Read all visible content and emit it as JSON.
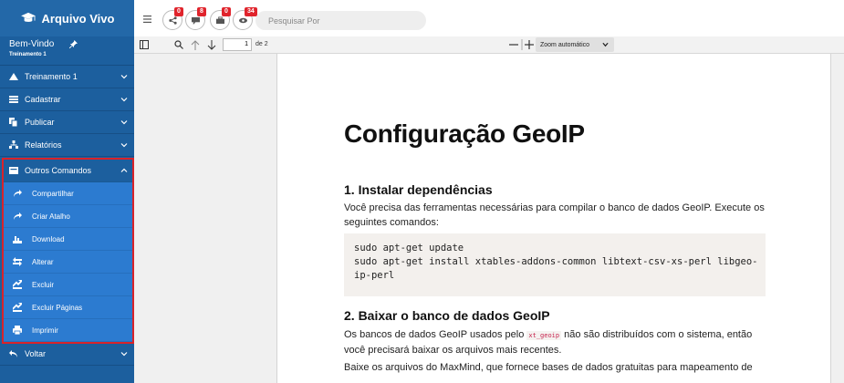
{
  "sidebar": {
    "brand": "Arquivo Vivo",
    "welcome": "Bem-Vindo",
    "user": "Treinamento 1",
    "menu": [
      {
        "label": "Treinamento 1"
      },
      {
        "label": "Cadastrar"
      },
      {
        "label": "Publicar"
      },
      {
        "label": "Relatórios"
      }
    ],
    "open_menu": {
      "label": "Outros Comandos",
      "items": [
        "Compartilhar",
        "Criar Atalho",
        "Download",
        "Alterar",
        "Excluir",
        "Excluir Páginas",
        "Imprimir"
      ]
    },
    "back": "Voltar"
  },
  "header": {
    "badges": [
      "0",
      "8",
      "0",
      "34"
    ],
    "search_placeholder": "Pesquisar Por"
  },
  "pdf_toolbar": {
    "page_current": "1",
    "page_total": "de 2",
    "zoom": "Zoom automático"
  },
  "document": {
    "title": "Configuração GeoIP",
    "section1_title": "1. Instalar dependências",
    "section1_text": "Você precisa das ferramentas necessárias para compilar o banco de dados GeoIP. Execute os seguintes comandos:",
    "code_lines": [
      "sudo apt-get update",
      "sudo apt-get install xtables-addons-common libtext-csv-xs-perl libgeo-",
      "ip-perl"
    ],
    "section2_title": "2. Baixar o banco de dados GeoIP",
    "section2_text_before": "Os bancos de dados GeoIP usados pelo ",
    "section2_code": "xt_geoip",
    "section2_text_after": " não são distribuídos com o sistema, então você precisará baixar os arquivos mais recentes.",
    "section2_text2": "Baixe os arquivos do MaxMind, que fornece bases de dados gratuitas para mapeamento de"
  },
  "colors": {
    "sidebar": "#1c5f9e",
    "submenu": "#2c7bd0",
    "highlight_border": "#d8232a",
    "badge": "#e0242c"
  }
}
